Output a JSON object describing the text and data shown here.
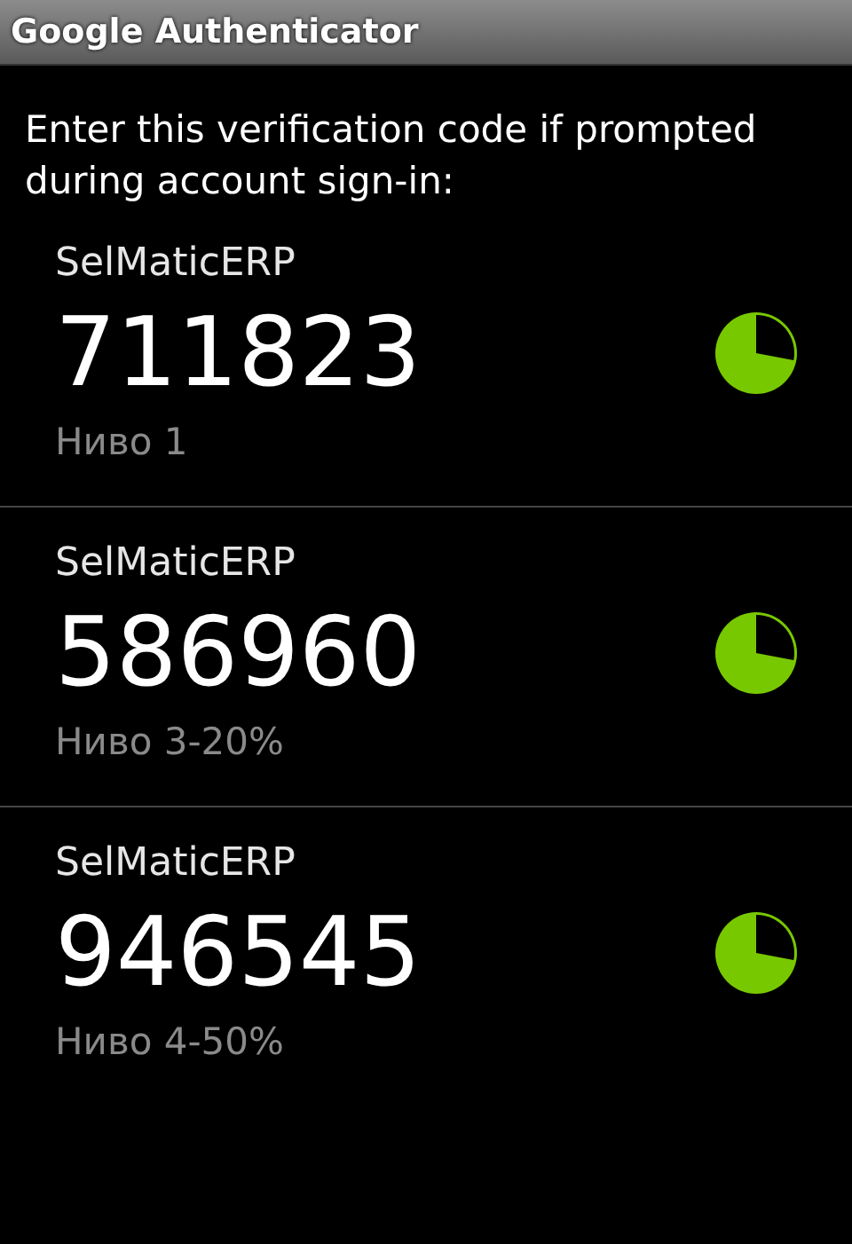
{
  "window": {
    "title": "Google Authenticator"
  },
  "prompt": "Enter this verification code if prompted during account sign-in:",
  "accounts": [
    {
      "name": "SelMaticERP",
      "code": "711823",
      "label": "Ниво 1"
    },
    {
      "name": "SelMaticERP",
      "code": "586960",
      "label": "Ниво 3-20%"
    },
    {
      "name": "SelMaticERP",
      "code": "946545",
      "label": "Ниво 4-50%"
    }
  ]
}
